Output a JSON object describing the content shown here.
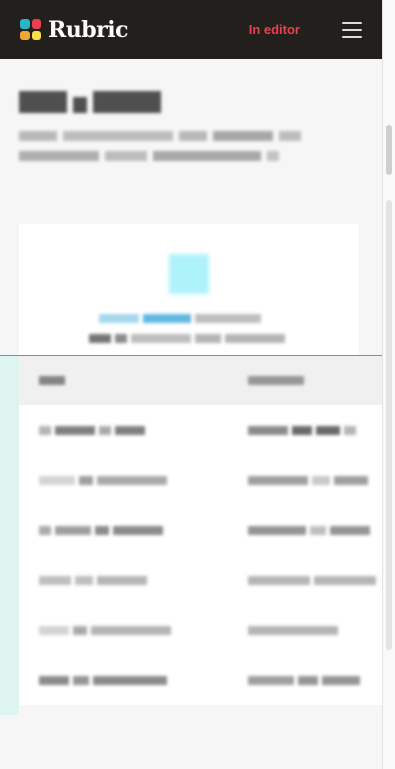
{
  "app": {
    "brand": "Rubric",
    "editor_link": "In editor"
  },
  "icons": {
    "logo": "rubric-logo-icon",
    "menu": "hamburger-menu-icon"
  },
  "colors": {
    "topbar": "#231f1d",
    "editor_link": "#e8404f",
    "accent_blue": "#3aa7d8",
    "accent_green": "#ddf5ee",
    "logo_squares": [
      "#25b7c4",
      "#e8404f",
      "#f1a634",
      "#f6e04a"
    ]
  }
}
